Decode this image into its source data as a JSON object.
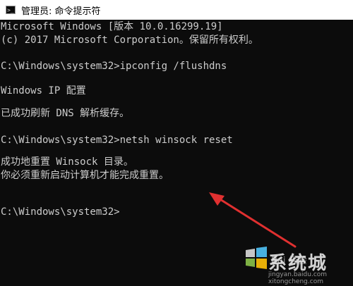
{
  "window": {
    "title": "管理员: 命令提示符",
    "icon": "cmd-icon"
  },
  "console": {
    "lines": [
      "Microsoft Windows [版本 10.0.16299.19]",
      "(c) 2017 Microsoft Corporation。保留所有权利。",
      "",
      "C:\\Windows\\system32>ipconfig /flushdns",
      "",
      "Windows IP 配置",
      "",
      "已成功刷新 DNS 解析缓存。",
      "",
      "C:\\Windows\\system32>netsh winsock reset",
      "",
      "成功地重置 Winsock 目录。",
      "你必须重新启动计算机才能完成重置。",
      "",
      "",
      "C:\\Windows\\system32>"
    ],
    "text_color": "#cccccc",
    "background": "#0c0c0c"
  },
  "annotation": {
    "arrow_color": "#e03030"
  },
  "watermark": {
    "brand": "系统城",
    "baidu": "Bai 经验",
    "url_baidu": "jingyan.baidu.com",
    "url_site": "xitongcheng.com",
    "icon": "windows-logo-icon"
  }
}
